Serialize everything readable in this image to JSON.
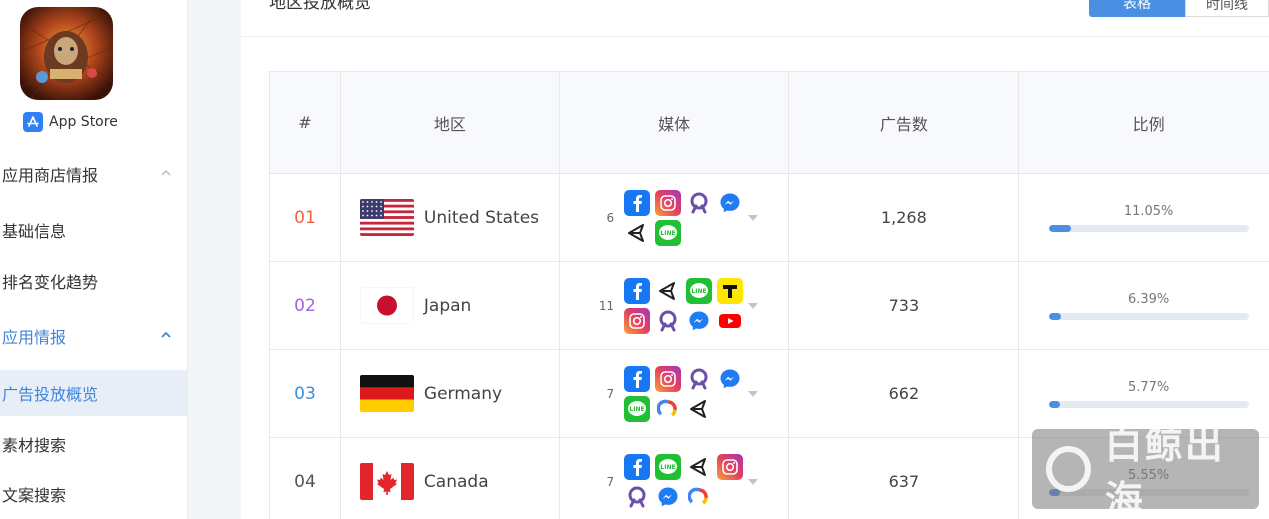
{
  "sidebar": {
    "store_label": "App Store",
    "nav": [
      {
        "label": "应用商店情报",
        "type": "group",
        "open": false
      },
      {
        "label": "基础信息",
        "type": "item"
      },
      {
        "label": "排名变化趋势",
        "type": "item"
      },
      {
        "label": "应用情报",
        "type": "group",
        "open": true
      },
      {
        "label": "广告投放概览",
        "type": "item",
        "active": true
      },
      {
        "label": "素材搜索",
        "type": "item"
      },
      {
        "label": "文案搜索",
        "type": "item"
      }
    ]
  },
  "main": {
    "section_title": "地区投放概览",
    "view_toggle": {
      "table_label": "表格",
      "timeline_label": "时间线"
    },
    "table": {
      "headers": [
        "#",
        "地区",
        "媒体",
        "广告数",
        "比例"
      ],
      "rows": [
        {
          "index": "01",
          "index_color": "#f0613a",
          "country": "United States",
          "flag": "us-flag",
          "media_count": "6",
          "media_icons": [
            "facebook-icon",
            "instagram-icon",
            "audience-network-icon",
            "messenger-icon",
            "unity-icon",
            "line-icon"
          ],
          "ads": "1,268",
          "ratio": "11.05%",
          "ratio_value": 0.1105
        },
        {
          "index": "02",
          "index_color": "#a064e0",
          "country": "Japan",
          "flag": "jp-flag",
          "media_count": "11",
          "media_icons": [
            "facebook-icon",
            "unity-icon",
            "line-icon",
            "tiktok-icon",
            "instagram-icon",
            "audience-network-icon",
            "messenger-icon",
            "youtube-icon"
          ],
          "ads": "733",
          "ratio": "6.39%",
          "ratio_value": 0.0639
        },
        {
          "index": "03",
          "index_color": "#3a8fd8",
          "country": "Germany",
          "flag": "de-flag",
          "media_count": "7",
          "media_icons": [
            "facebook-icon",
            "instagram-icon",
            "audience-network-icon",
            "messenger-icon",
            "line-icon",
            "google-ads-icon",
            "unity-icon"
          ],
          "ads": "662",
          "ratio": "5.77%",
          "ratio_value": 0.0577
        },
        {
          "index": "04",
          "index_color": "#555555",
          "country": "Canada",
          "flag": "ca-flag",
          "media_count": "7",
          "media_icons": [
            "facebook-icon",
            "line-icon",
            "unity-icon",
            "instagram-icon",
            "audience-network-icon",
            "messenger-icon",
            "google-ads-icon"
          ],
          "ads": "637",
          "ratio": "5.55%",
          "ratio_value": 0.0555
        }
      ]
    }
  },
  "watermark": {
    "text": "白鲸出海"
  },
  "colors": {
    "accent": "#4a90e2",
    "sidebar_active_bg": "#e7eef8"
  }
}
